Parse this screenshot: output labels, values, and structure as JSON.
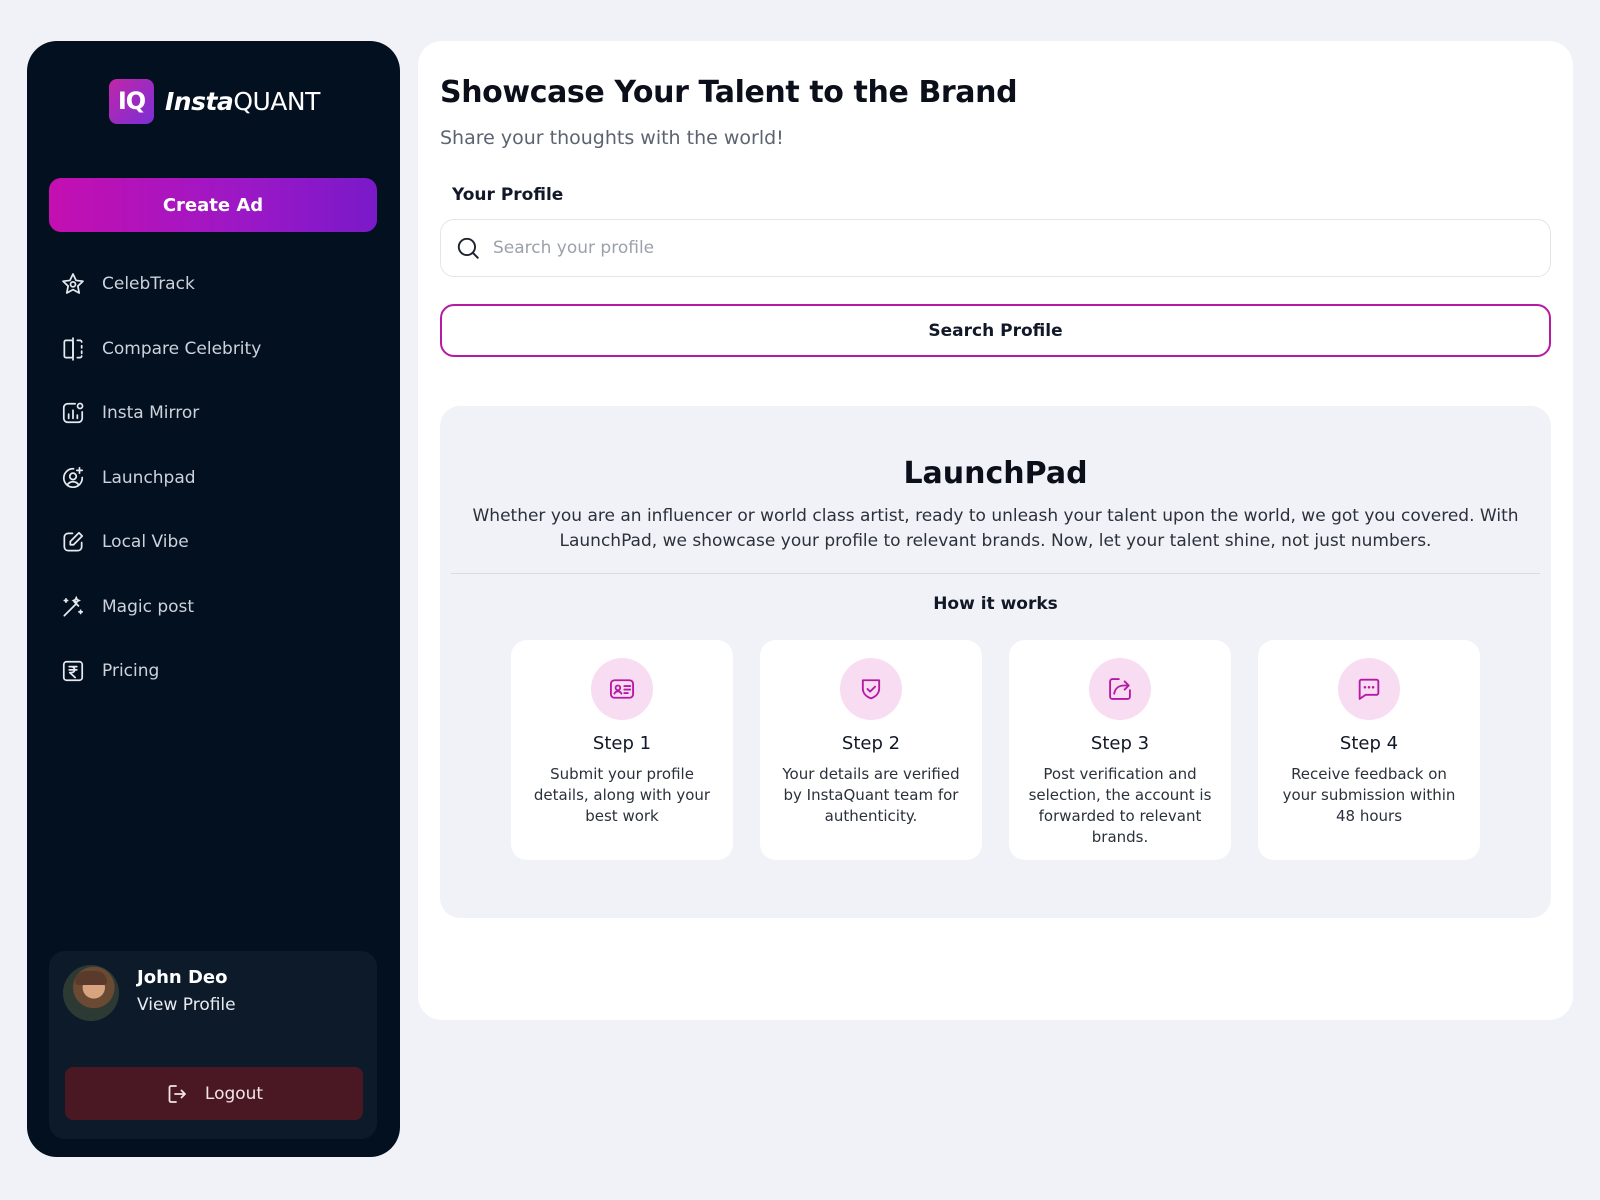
{
  "brand": {
    "badge": "IQ",
    "name_italic": "Insta",
    "name_caps": "QUANT"
  },
  "sidebar": {
    "create_ad_label": "Create Ad",
    "items": [
      {
        "label": "CelebTrack",
        "icon": "star-icon"
      },
      {
        "label": "Compare Celebrity",
        "icon": "compare-icon"
      },
      {
        "label": "Insta Mirror",
        "icon": "chart-icon"
      },
      {
        "label": "Launchpad",
        "icon": "user-plus-icon"
      },
      {
        "label": "Local Vibe",
        "icon": "edit-icon"
      },
      {
        "label": "Magic post",
        "icon": "magic-wand-icon"
      },
      {
        "label": "Pricing",
        "icon": "rupee-icon"
      }
    ],
    "profile": {
      "name": "John Deo",
      "view_label": "View Profile"
    },
    "logout_label": "Logout"
  },
  "main": {
    "title": "Showcase Your Talent to the Brand",
    "subtitle": "Share your thoughts with the world!",
    "profile_label": "Your Profile",
    "search": {
      "placeholder": "Search your profile",
      "value": ""
    },
    "search_button": "Search Profile",
    "launchpad": {
      "title": "LaunchPad",
      "description": "Whether you are an influencer or world class artist, ready to unleash your talent upon the world, we got you covered. With LaunchPad, we showcase your profile to relevant brands. Now, let your talent shine, not just numbers.",
      "how_it_works": "How it works",
      "steps": [
        {
          "title": "Step 1",
          "text": "Submit your profile details, along with your best work",
          "icon": "id-card-icon"
        },
        {
          "title": "Step 2",
          "text": "Your details are verified by InstaQuant team for authenticity.",
          "icon": "shield-check-icon"
        },
        {
          "title": "Step 3",
          "text": "Post verification and selection, the account is forwarded to relevant brands.",
          "icon": "share-icon"
        },
        {
          "title": "Step 4",
          "text": "Receive feedback on your submission within 48 hours",
          "icon": "message-icon"
        }
      ]
    }
  },
  "colors": {
    "accent": "#b61aa5",
    "sidebar_bg": "#03101f",
    "logout_bg": "#4a1822",
    "icon_bg": "#f8dcf1"
  }
}
